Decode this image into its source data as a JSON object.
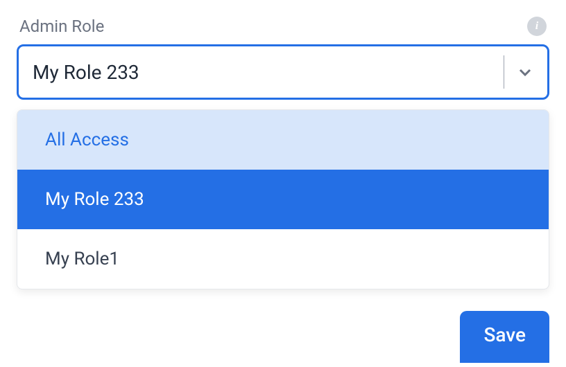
{
  "field": {
    "label": "Admin Role",
    "value": "My Role 233"
  },
  "options": [
    {
      "label": "All Access",
      "state": "highlighted"
    },
    {
      "label": "My Role 233",
      "state": "selected"
    },
    {
      "label": "My Role1",
      "state": "normal"
    }
  ],
  "actions": {
    "save": "Save"
  }
}
